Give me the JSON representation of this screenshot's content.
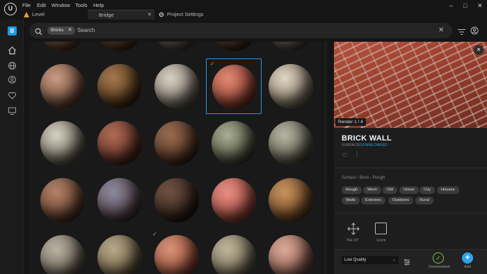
{
  "titlebar": {
    "menu": [
      "File",
      "Edit",
      "Window",
      "Tools",
      "Help"
    ],
    "tabs": [
      {
        "label": "Level"
      },
      {
        "label": "Bridge"
      },
      {
        "label": "Project Settings"
      }
    ],
    "logo_letter": "U",
    "controls": [
      "–",
      "□",
      "✕"
    ]
  },
  "nav": {
    "logo_letter": "B",
    "icons": [
      "home-icon",
      "globe-icon",
      "user-icon",
      "heart-icon",
      "monitor-icon"
    ]
  },
  "search": {
    "chip_label": "Bricks",
    "chip_close": "✕",
    "placeholder": "Search",
    "clear": "✕"
  },
  "grid": {
    "rows": [
      {
        "partial": true,
        "spheres": [
          {
            "colors": [
              "#a8795a",
              "#5a3a28"
            ]
          },
          {
            "colors": [
              "#8a6a4a",
              "#4a321f"
            ]
          },
          {
            "colors": [
              "#8d8378",
              "#4e463e"
            ]
          },
          {
            "colors": [
              "#7a5c48",
              "#3e2c22"
            ]
          },
          {
            "colors": [
              "#9a8e82",
              "#514840"
            ]
          }
        ]
      },
      {
        "spheres": [
          {
            "colors": [
              "#c99a80",
              "#6e4a38"
            ]
          },
          {
            "colors": [
              "#a5774c",
              "#4a3016"
            ]
          },
          {
            "colors": [
              "#d8cfc3",
              "#7a7065"
            ]
          },
          {
            "colors": [
              "#e08772",
              "#8f3b2c"
            ],
            "selected": true,
            "checked": true
          },
          {
            "colors": [
              "#e0d5c2",
              "#807462"
            ]
          }
        ]
      },
      {
        "spheres": [
          {
            "colors": [
              "#d6d1c2",
              "#6a6456"
            ]
          },
          {
            "colors": [
              "#b06a52",
              "#5a2c22"
            ]
          },
          {
            "colors": [
              "#9a6a4c",
              "#4a2e20"
            ]
          },
          {
            "colors": [
              "#a9ad92",
              "#4a4d3c"
            ]
          },
          {
            "colors": [
              "#b6b5a2",
              "#5c5b4c"
            ]
          }
        ]
      },
      {
        "spheres": [
          {
            "colors": [
              "#b58266",
              "#5c3a2a"
            ]
          },
          {
            "colors": [
              "#8c8aa0",
              "#4c3a3e"
            ]
          },
          {
            "colors": [
              "#6e5040",
              "#2e1e16"
            ]
          },
          {
            "colors": [
              "#e88d82",
              "#a0493e"
            ]
          },
          {
            "colors": [
              "#c9925a",
              "#6a4422"
            ]
          }
        ]
      },
      {
        "partial": true,
        "spheres": [
          {
            "colors": [
              "#b9b2a2",
              "#6a6254"
            ]
          },
          {
            "colors": [
              "#b6a888",
              "#6a5c40"
            ]
          },
          {
            "colors": [
              "#d89276",
              "#8e4632"
            ],
            "checked": true
          },
          {
            "colors": [
              "#bfb59a",
              "#6e6650"
            ]
          },
          {
            "colors": [
              "#dca898",
              "#8a5a4c"
            ]
          }
        ]
      }
    ]
  },
  "preview": {
    "close": "✕",
    "render_label": "Render 1 / 4",
    "arrows": "‹  ›"
  },
  "asset": {
    "title": "BRICK WALL",
    "type": "SURFACE",
    "status": "DOWNLOADED",
    "heart": "♡",
    "more": "⋮",
    "breadcrumb": "Surface  ›  Brick  ›  Rough",
    "tags": [
      "Rough",
      "Worn",
      "Old",
      "Urban",
      "City",
      "Houses",
      "Walls",
      "Exteriors",
      "Outdoors",
      "Rural"
    ],
    "tile_label": "Tile XY",
    "size_label": "1x1m"
  },
  "bottom": {
    "quality": "Low Quality",
    "quality_chevron": "⌄",
    "download_icon_glyph": "✓",
    "download_label": "Downloaded",
    "add_glyph": "+",
    "add_label": "Add"
  },
  "colors": {
    "accent": "#2d9be0",
    "downloaded": "#7fbf4d"
  }
}
